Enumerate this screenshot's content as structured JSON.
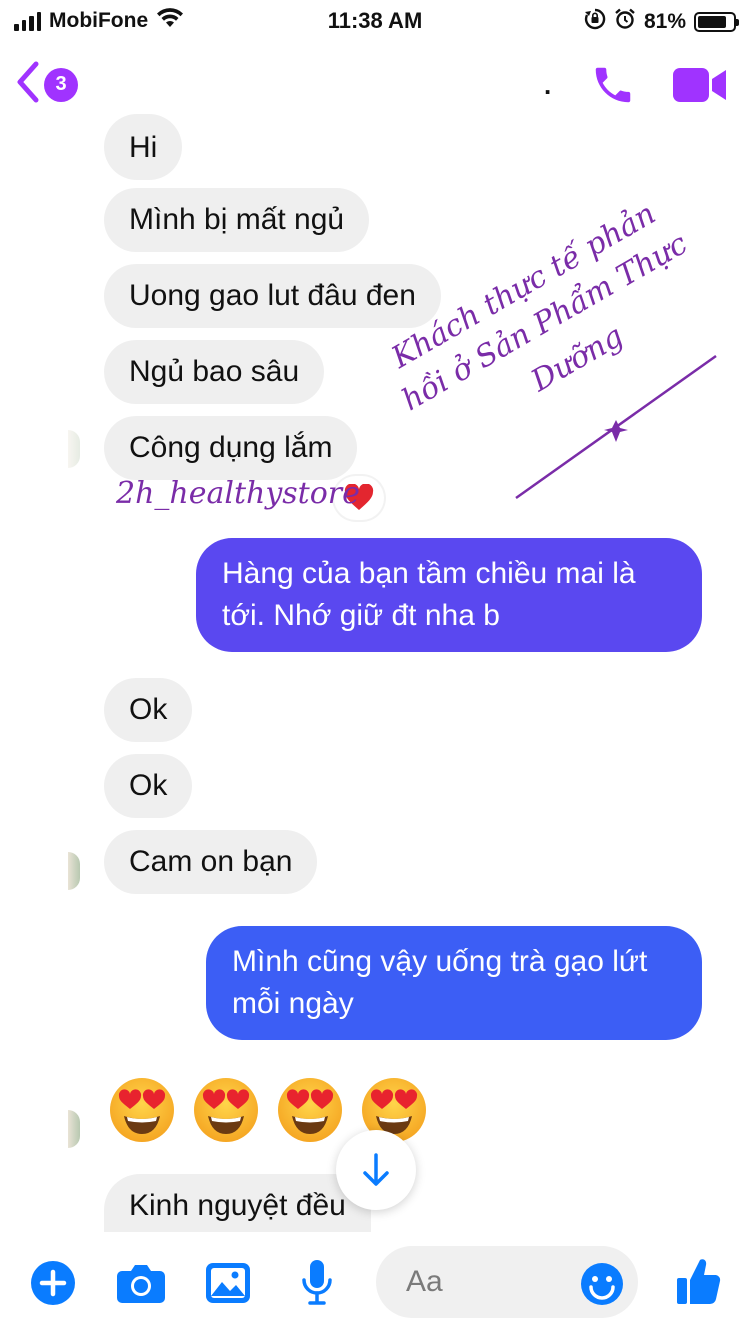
{
  "status_bar": {
    "carrier": "MobiFone",
    "time": "11:38 AM",
    "battery_percent": "81%",
    "battery_level": 0.81
  },
  "header": {
    "back_badge": "3",
    "name_fragment": ".",
    "accent_color": "#a033ff"
  },
  "messages": {
    "incoming_1": [
      "Hi",
      "Mình bị mất ngủ",
      "Uong gao lut đâu đen",
      "Ngủ bao sâu",
      "Công dụng lắm"
    ],
    "outgoing_1": "Hàng của bạn tầm chiều mai là tới. Nhớ giữ đt nha b",
    "incoming_2": [
      "Ok",
      "Ok",
      "Cam on bạn"
    ],
    "outgoing_2": "Mình cũng vậy uống trà gạo lứt mỗi ngày",
    "emoji_count": 4,
    "incoming_3": "Kinh nguyệt đều"
  },
  "overlay": {
    "line1": "Khách thực tế phản",
    "line2": "hồi ở Sản Phẩm Thực",
    "line3": "Dưỡng",
    "watermark": "2h_healthystore"
  },
  "composer": {
    "placeholder": "Aa"
  },
  "colors": {
    "outgoing_1": "#5a48f0",
    "outgoing_2": "#3c5ef5",
    "icon_blue": "#0a7cff",
    "overlay_purple": "#7a2ca8"
  }
}
